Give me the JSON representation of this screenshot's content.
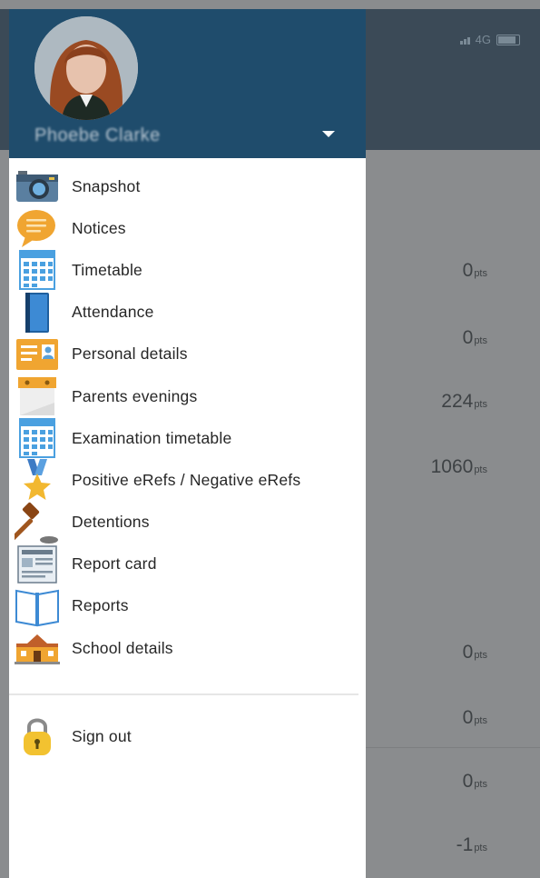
{
  "status_bar": {
    "network": "4G"
  },
  "drawer": {
    "user_name": "Phoebe Clarke",
    "menu": [
      {
        "label": "Snapshot",
        "icon": "camera-icon"
      },
      {
        "label": "Notices",
        "icon": "speech-bubble-icon"
      },
      {
        "label": "Timetable",
        "icon": "calendar-grid-icon"
      },
      {
        "label": "Attendance",
        "icon": "register-book-icon"
      },
      {
        "label": "Personal details",
        "icon": "id-card-icon"
      },
      {
        "label": "Parents evenings",
        "icon": "desk-calendar-icon"
      },
      {
        "label": "Examination timetable",
        "icon": "calendar-grid-icon"
      },
      {
        "label": "Positive eRefs / Negative eRefs",
        "icon": "star-medal-icon"
      },
      {
        "label": "Detentions",
        "icon": "gavel-icon"
      },
      {
        "label": "Report card",
        "icon": "report-card-icon"
      },
      {
        "label": "Reports",
        "icon": "open-book-icon"
      },
      {
        "label": "School details",
        "icon": "school-building-icon"
      }
    ],
    "sign_out": {
      "label": "Sign out",
      "icon": "padlock-icon"
    }
  },
  "background_points": [
    {
      "value": "0",
      "unit": "pts"
    },
    {
      "value": "0",
      "unit": "pts"
    },
    {
      "value": "224",
      "unit": "pts"
    },
    {
      "value": "1060",
      "unit": "pts"
    },
    {
      "value": "0",
      "unit": "pts"
    },
    {
      "value": "0",
      "unit": "pts"
    },
    {
      "value": "0",
      "unit": "pts"
    },
    {
      "value": "-1",
      "unit": "pts"
    }
  ],
  "colors": {
    "drawer_header": "#1f4c6c",
    "app_header": "#3b4a57",
    "overlay": "#8a8c8e"
  }
}
